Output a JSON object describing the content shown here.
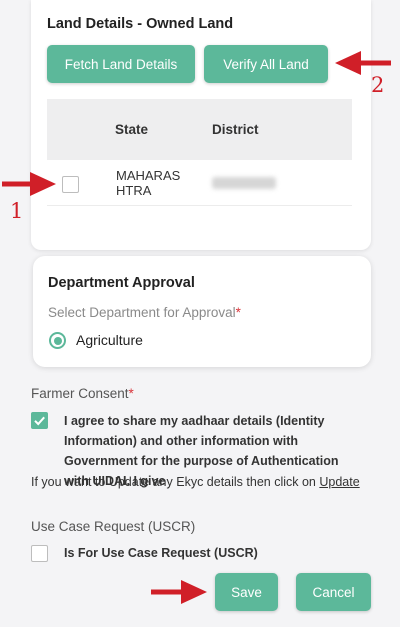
{
  "land_section": {
    "title": "Land Details - Owned Land",
    "fetch_button": "Fetch Land Details",
    "verify_button": "Verify All Land",
    "table": {
      "columns": [
        "State",
        "District"
      ],
      "rows": [
        {
          "state": "MAHARAS HTRA",
          "district": "(redacted)"
        }
      ]
    }
  },
  "department_approval": {
    "title": "Department Approval",
    "select_label": "Select Department for Approval",
    "required_mark": "*",
    "selected_option": "Agriculture"
  },
  "farmer_consent": {
    "label": "Farmer Consent",
    "required_mark": "*",
    "checked": true,
    "text": "I agree to share my aadhaar details (Identity Information) and other information with Government for the purpose of Authentication with UIDAI. I give",
    "update_prompt": "If you want to Update any Ekyc details then click on ",
    "update_link": "Update"
  },
  "use_case": {
    "label": "Use Case Request (USCR)",
    "checkbox_label": "Is For Use Case Request (USCR)",
    "checked": false
  },
  "footer": {
    "save": "Save",
    "cancel": "Cancel"
  },
  "annotations": {
    "step_1": "1",
    "step_2": "2"
  },
  "colors": {
    "accent": "#5cb89a",
    "annotation": "#d01f28",
    "required": "#d9343a"
  }
}
